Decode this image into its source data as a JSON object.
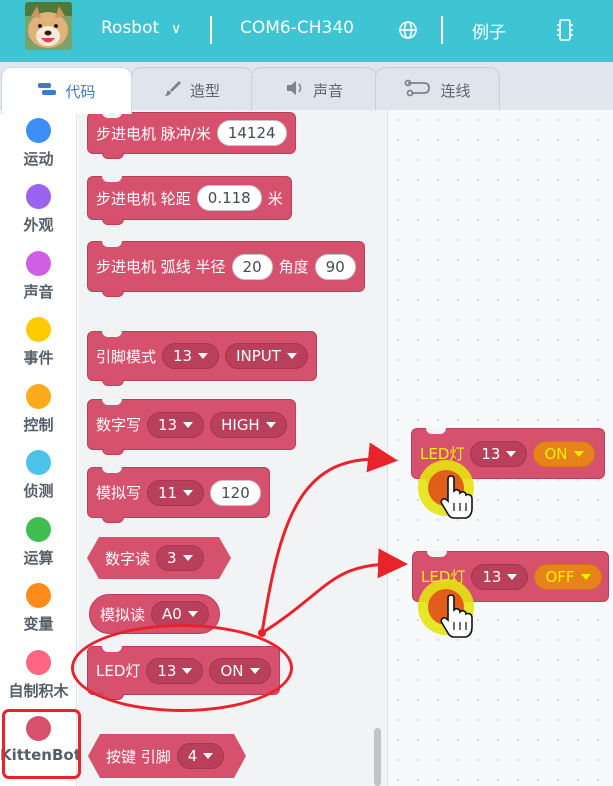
{
  "header": {
    "device": "Rosbot",
    "device_caret": "∨",
    "port": "COM6-CH340",
    "examples": "例子",
    "globe_icon": "globe-icon",
    "chip_icon": "chip-icon"
  },
  "tabs": [
    {
      "label": "代码",
      "icon": "code-icon",
      "active": true
    },
    {
      "label": "造型",
      "icon": "brush-icon",
      "active": false
    },
    {
      "label": "声音",
      "icon": "speaker-icon",
      "active": false
    },
    {
      "label": "连线",
      "icon": "connection-icon",
      "active": false
    }
  ],
  "categories": [
    {
      "label": "运动",
      "color": "#3b8ff6"
    },
    {
      "label": "外观",
      "color": "#9a63f0"
    },
    {
      "label": "声音",
      "color": "#cf60e4"
    },
    {
      "label": "事件",
      "color": "#fecb00"
    },
    {
      "label": "控制",
      "color": "#fbab1c"
    },
    {
      "label": "侦测",
      "color": "#4cc1e9"
    },
    {
      "label": "运算",
      "color": "#40be51"
    },
    {
      "label": "变量",
      "color": "#ff8c1a"
    },
    {
      "label": "自制积木",
      "color": "#ff6680"
    },
    {
      "label": "KittenBot",
      "color": "#d5516e"
    }
  ],
  "palette": {
    "b1": {
      "label": "步进电机 脉冲/米",
      "value": "14124"
    },
    "b2": {
      "label": "步进电机 轮距",
      "value": "0.118",
      "unit": "米"
    },
    "b3": {
      "label": "步进电机 弧线 半径",
      "v1": "20",
      "mid": "角度",
      "v2": "90"
    },
    "b4": {
      "label": "引脚模式",
      "pin": "13",
      "mode": "INPUT"
    },
    "b5": {
      "label": "数字写",
      "pin": "13",
      "level": "HIGH"
    },
    "b6": {
      "label": "模拟写",
      "pin": "11",
      "value": "120"
    },
    "b7": {
      "label": "数字读",
      "pin": "3"
    },
    "b8": {
      "label": "模拟读",
      "pin": "A0"
    },
    "b9": {
      "label": "LED灯",
      "pin": "13",
      "state": "ON"
    },
    "b10": {
      "label": "按键 引脚",
      "pin": "4"
    }
  },
  "workspace": {
    "w1": {
      "label": "LED灯",
      "pin": "13",
      "state": "ON"
    },
    "w2": {
      "label": "LED灯",
      "pin": "13",
      "state": "OFF"
    }
  },
  "annotation_color": "#e8232a"
}
